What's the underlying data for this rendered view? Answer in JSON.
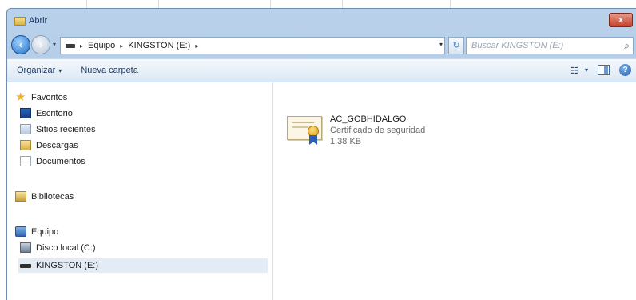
{
  "window": {
    "title": "Abrir",
    "close_label": "x"
  },
  "address": {
    "crumbs": [
      "Equipo",
      "KINGSTON (E:)"
    ],
    "separator": "▸",
    "dropdown": "▾"
  },
  "search": {
    "placeholder": "Buscar KINGSTON (E:)",
    "icon": "search-icon"
  },
  "toolbar": {
    "organize_label": "Organizar",
    "new_folder_label": "Nueva carpeta",
    "caret": "▾"
  },
  "nav": {
    "favorites": "Favoritos",
    "desktop": "Escritorio",
    "recent": "Sitios recientes",
    "downloads": "Descargas",
    "documents": "Documentos",
    "libraries": "Bibliotecas",
    "computer": "Equipo",
    "local_disk": "Disco local (C:)",
    "usb_drive": "KINGSTON (E:)"
  },
  "files": [
    {
      "name": "AC_GOBHIDALGO",
      "type": "Certificado de seguridad",
      "size": "1.38 KB",
      "icon": "certificate-icon"
    }
  ]
}
